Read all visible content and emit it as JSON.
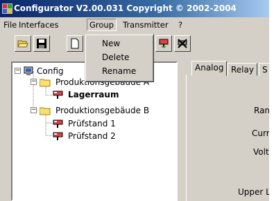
{
  "window": {
    "title": "Configurator  V2.00.031 Copyright © 2002-2004"
  },
  "menubar": {
    "items": [
      "File",
      "Interfaces",
      "Group",
      "Transmitter",
      "?"
    ]
  },
  "group_menu": {
    "items": [
      "New",
      "Delete",
      "Rename"
    ]
  },
  "toolbar": {
    "buttons": [
      "open-folder-icon",
      "save-icon",
      "new-document-icon",
      "transmitter-icon",
      "delete-transmitter-icon"
    ]
  },
  "tree": {
    "root": "Config",
    "groups": [
      {
        "label": "Produktionsgebäude A",
        "children": [
          "Lagerraum"
        ]
      },
      {
        "label": "Produktionsgebäude B",
        "children": [
          "Prüfstand 1",
          "Prüfstand 2"
        ]
      }
    ]
  },
  "tabs": [
    "Analog",
    "Relay",
    "S"
  ],
  "fields": {
    "range_label": "Ran",
    "current_label": "Curr",
    "voltage_label": "Volt",
    "upper_label": "Upper L"
  }
}
